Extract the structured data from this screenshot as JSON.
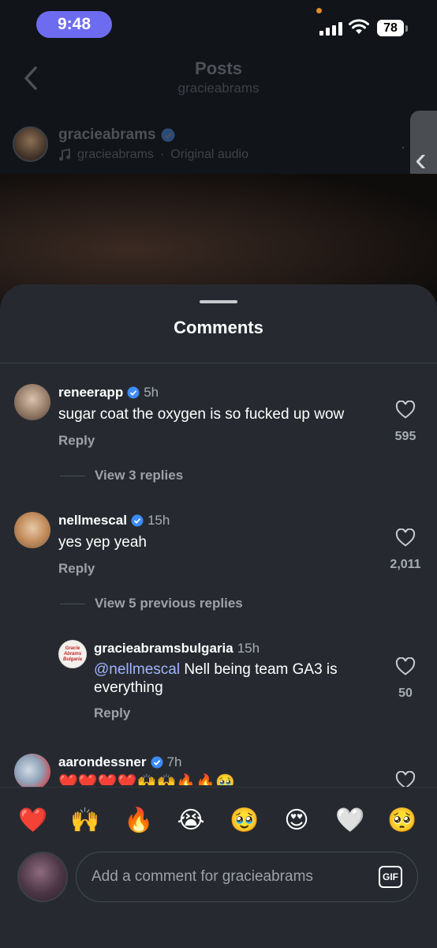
{
  "status_bar": {
    "time": "9:48",
    "battery": "78"
  },
  "nav": {
    "title": "Posts",
    "subtitle": "gracieabrams"
  },
  "post": {
    "username": "gracieabrams",
    "audio_user": "gracieabrams",
    "audio_separator": "·",
    "audio_label": "Original audio"
  },
  "sheet": {
    "title": "Comments"
  },
  "comments": [
    {
      "username": "reneerapp",
      "verified": true,
      "time": "5h",
      "text": "sugar coat the oxygen is so fucked up wow",
      "reply": "Reply",
      "likes": "595",
      "view_replies": "View 3 replies"
    },
    {
      "username": "nellmescal",
      "verified": true,
      "time": "15h",
      "text": "yes yep yeah",
      "reply": "Reply",
      "likes": "2,011",
      "view_replies": "View 5 previous replies"
    },
    {
      "username": "aarondessner",
      "verified": true,
      "time": "7h",
      "text": "❤️❤️❤️❤️🙌🙌🔥🔥🥹"
    }
  ],
  "nested_reply": {
    "username": "gracieabramsbulgaria",
    "time": "15h",
    "mention": "@nellmescal",
    "text": " Nell being team GA3 is everything",
    "reply": "Reply",
    "likes": "50",
    "avatar_text": "Gracie Abrams Bulgaria"
  },
  "reactions": [
    "❤️",
    "🙌",
    "🔥",
    "😭",
    "🥹",
    "😍",
    "🤍",
    "🥺"
  ],
  "composer": {
    "placeholder": "Add a comment for gracieabrams",
    "gif_label": "GIF"
  },
  "colors": {
    "sheet": "#262a30",
    "verified": "#3d8bf5",
    "mention": "#9fb4ff",
    "time_pill": "#6d6cf0"
  }
}
